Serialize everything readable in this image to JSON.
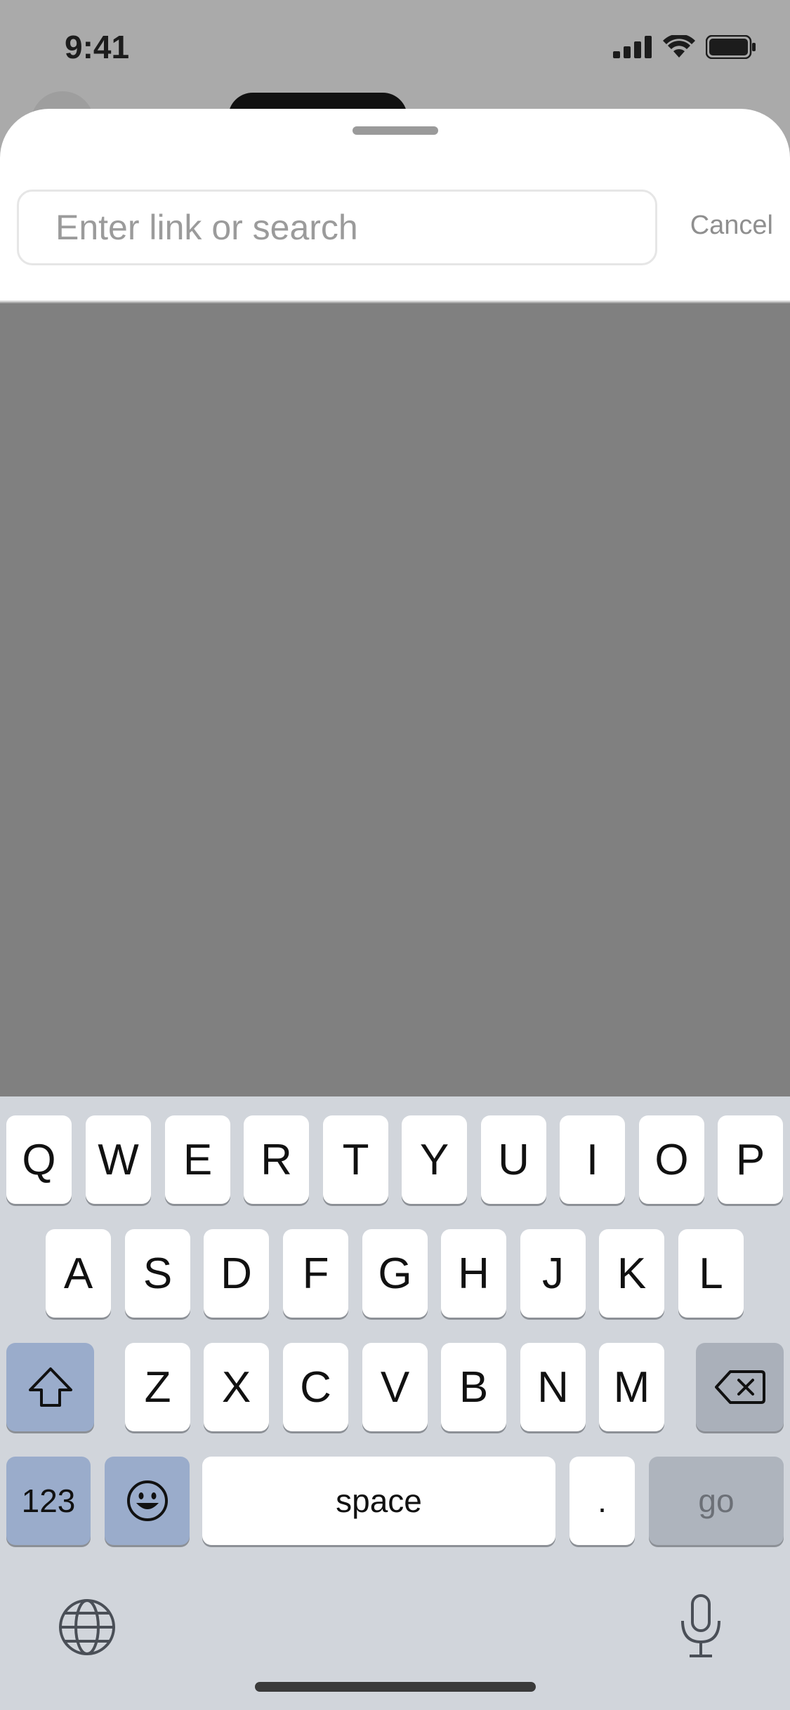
{
  "status_bar": {
    "time": "9:41",
    "icons": [
      "signal-icon",
      "wifi-icon",
      "battery-icon"
    ]
  },
  "search": {
    "placeholder": "Enter link or search",
    "value": "",
    "cancel_label": "Cancel"
  },
  "keyboard": {
    "row1": [
      "Q",
      "W",
      "E",
      "R",
      "T",
      "Y",
      "U",
      "I",
      "O",
      "P"
    ],
    "row2": [
      "A",
      "S",
      "D",
      "F",
      "G",
      "H",
      "J",
      "K",
      "L"
    ],
    "row3": [
      "Z",
      "X",
      "C",
      "V",
      "B",
      "N",
      "M"
    ],
    "numbers_label": "123",
    "space_label": "space",
    "period_label": ".",
    "go_label": "go",
    "icons": [
      "shift-icon",
      "backspace-icon",
      "emoji-icon",
      "globe-icon",
      "microphone-icon"
    ]
  },
  "colors": {
    "backdrop": "#808080",
    "keyboard_bg": "#d1d5db",
    "special_key": "#9aaccb"
  }
}
